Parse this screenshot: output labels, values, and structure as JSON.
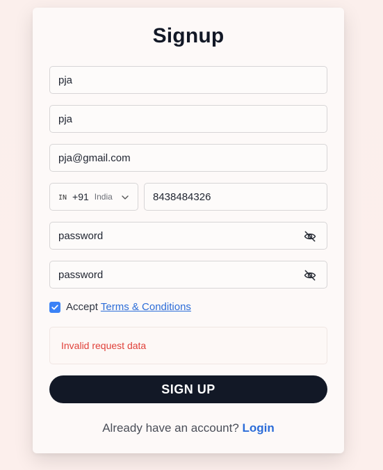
{
  "page": {
    "title": "Signup"
  },
  "form": {
    "first_name": {
      "value": "pja",
      "placeholder": ""
    },
    "last_name": {
      "value": "pja",
      "placeholder": ""
    },
    "email": {
      "value": "pja@gmail.com",
      "placeholder": ""
    },
    "phone": {
      "country_flag": "IN",
      "dial_code": "+91",
      "country_name": "India",
      "number": "8438484326"
    },
    "password": {
      "value": "password",
      "visibility_icon": "eye-off-icon"
    },
    "confirm_password": {
      "value": "password",
      "visibility_icon": "eye-off-icon"
    },
    "terms": {
      "checked": true,
      "prefix": "Accept",
      "link_label": "Terms & Conditions"
    },
    "error_message": "Invalid request data",
    "submit_label": "SIGN UP"
  },
  "footer": {
    "prompt": "Already have an account?",
    "login_label": "Login"
  },
  "colors": {
    "primary_button": "#121826",
    "link": "#2b6cd8",
    "error": "#e0413a",
    "checkbox": "#3b82f6"
  }
}
